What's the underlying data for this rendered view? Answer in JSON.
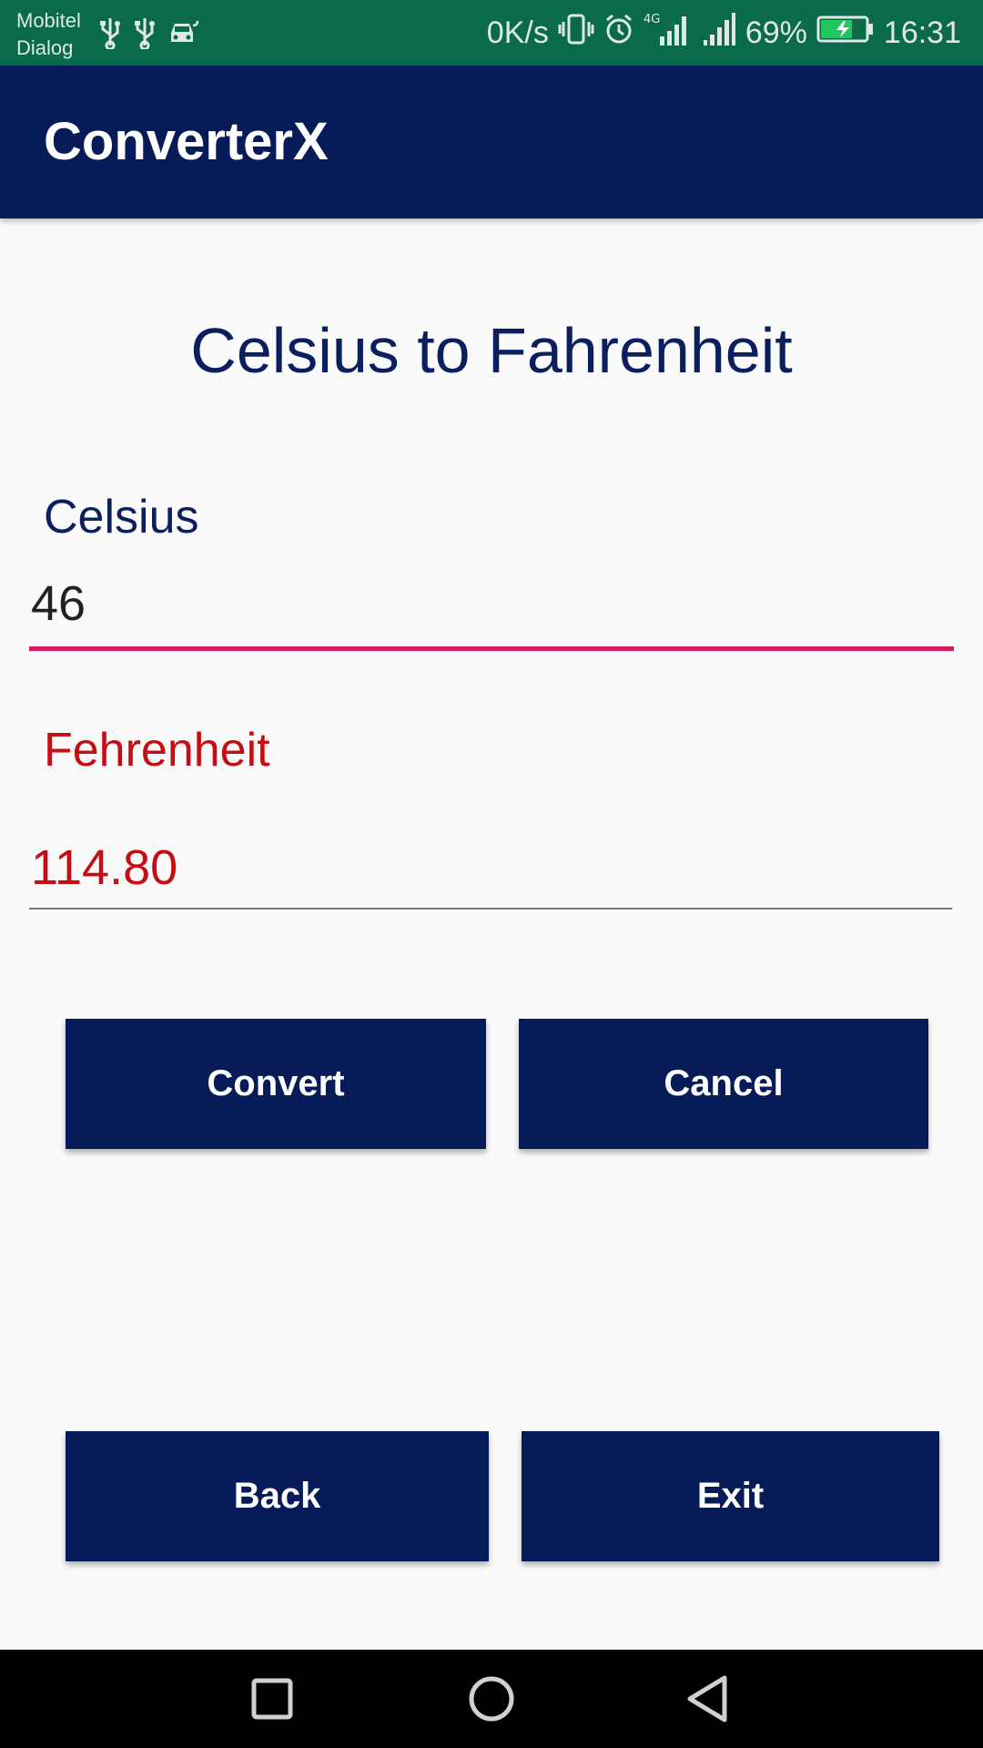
{
  "status_bar": {
    "carrier_line1": "Mobitel",
    "carrier_line2": "Dialog",
    "net_speed": "0K/s",
    "network_type": "4G",
    "battery_percent": "69%",
    "time": "16:31",
    "icons_left": [
      "usb-icon",
      "usb-icon",
      "car-icon"
    ],
    "icons_right": [
      "vibrate-icon",
      "alarm-icon",
      "signal-4g-icon",
      "signal-icon",
      "battery-charging-icon"
    ],
    "background_color": "#0a6a4c"
  },
  "app_bar": {
    "title": "ConverterX",
    "background_color": "#061b57"
  },
  "main": {
    "page_title": "Celsius to Fahrenheit",
    "celsius_label": "Celsius",
    "celsius_value": "46",
    "fahrenheit_label": "Fehrenheit",
    "fahrenheit_value": "114.80",
    "accent_color": "#d81b60",
    "result_color": "#c40d14"
  },
  "buttons": {
    "convert": "Convert",
    "cancel": "Cancel",
    "back": "Back",
    "exit": "Exit"
  },
  "nav_bar": {
    "icons": [
      "recent-apps-icon",
      "home-icon",
      "back-icon"
    ]
  }
}
